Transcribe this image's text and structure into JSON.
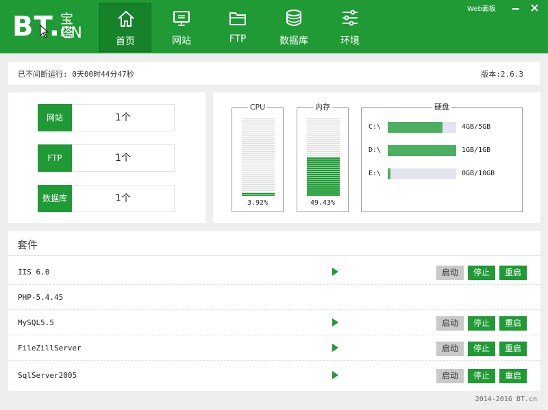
{
  "logo": {
    "bt": "BT.",
    "cn_zh": "宝塔",
    "cn_en": "CN"
  },
  "nav": [
    {
      "label": "首页",
      "icon": "home-icon"
    },
    {
      "label": "网站",
      "icon": "monitor-icon"
    },
    {
      "label": "FTP",
      "icon": "folder-icon"
    },
    {
      "label": "数据库",
      "icon": "database-icon"
    },
    {
      "label": "环境",
      "icon": "sliders-icon"
    }
  ],
  "window": {
    "title": "Web面板",
    "minimize_icon": "minimize-icon",
    "close_icon": "close-icon"
  },
  "info": {
    "uptime": "已不间断运行: 0天00时44分47秒",
    "version": "版本:2.6.3"
  },
  "counts": [
    {
      "label": "网站",
      "value": "1个"
    },
    {
      "label": "FTP",
      "value": "1个"
    },
    {
      "label": "数据库",
      "value": "1个"
    }
  ],
  "resources": {
    "cpu": {
      "title": "CPU",
      "percent_text": "3.92%",
      "fraction": 0.0392
    },
    "memory": {
      "title": "内存",
      "percent_text": "49.43%",
      "fraction": 0.4943
    },
    "disk": {
      "title": "硬盘",
      "drives": [
        {
          "name": "C:\\",
          "usage": "4GB/5GB",
          "fraction": 0.8
        },
        {
          "name": "D:\\",
          "usage": "1GB/1GB",
          "fraction": 1.0
        },
        {
          "name": "E:\\",
          "usage": "0GB/10GB",
          "fraction": 0.04
        }
      ]
    }
  },
  "suite": {
    "title": "套件",
    "items": [
      {
        "name": "IIS 6.0",
        "has_controls": true
      },
      {
        "name": "PHP-5.4.45",
        "has_controls": false
      },
      {
        "name": "MySQL5.5",
        "has_controls": true
      },
      {
        "name": "FileZillServer",
        "has_controls": true
      },
      {
        "name": "SqlServer2005",
        "has_controls": true
      }
    ],
    "start_label": "启动",
    "stop_label": "停止",
    "restart_label": "重启"
  },
  "footer": "2014-2016 BT.cn",
  "colors": {
    "brand": "#1f9a35",
    "brand_dark": "#16822a"
  }
}
